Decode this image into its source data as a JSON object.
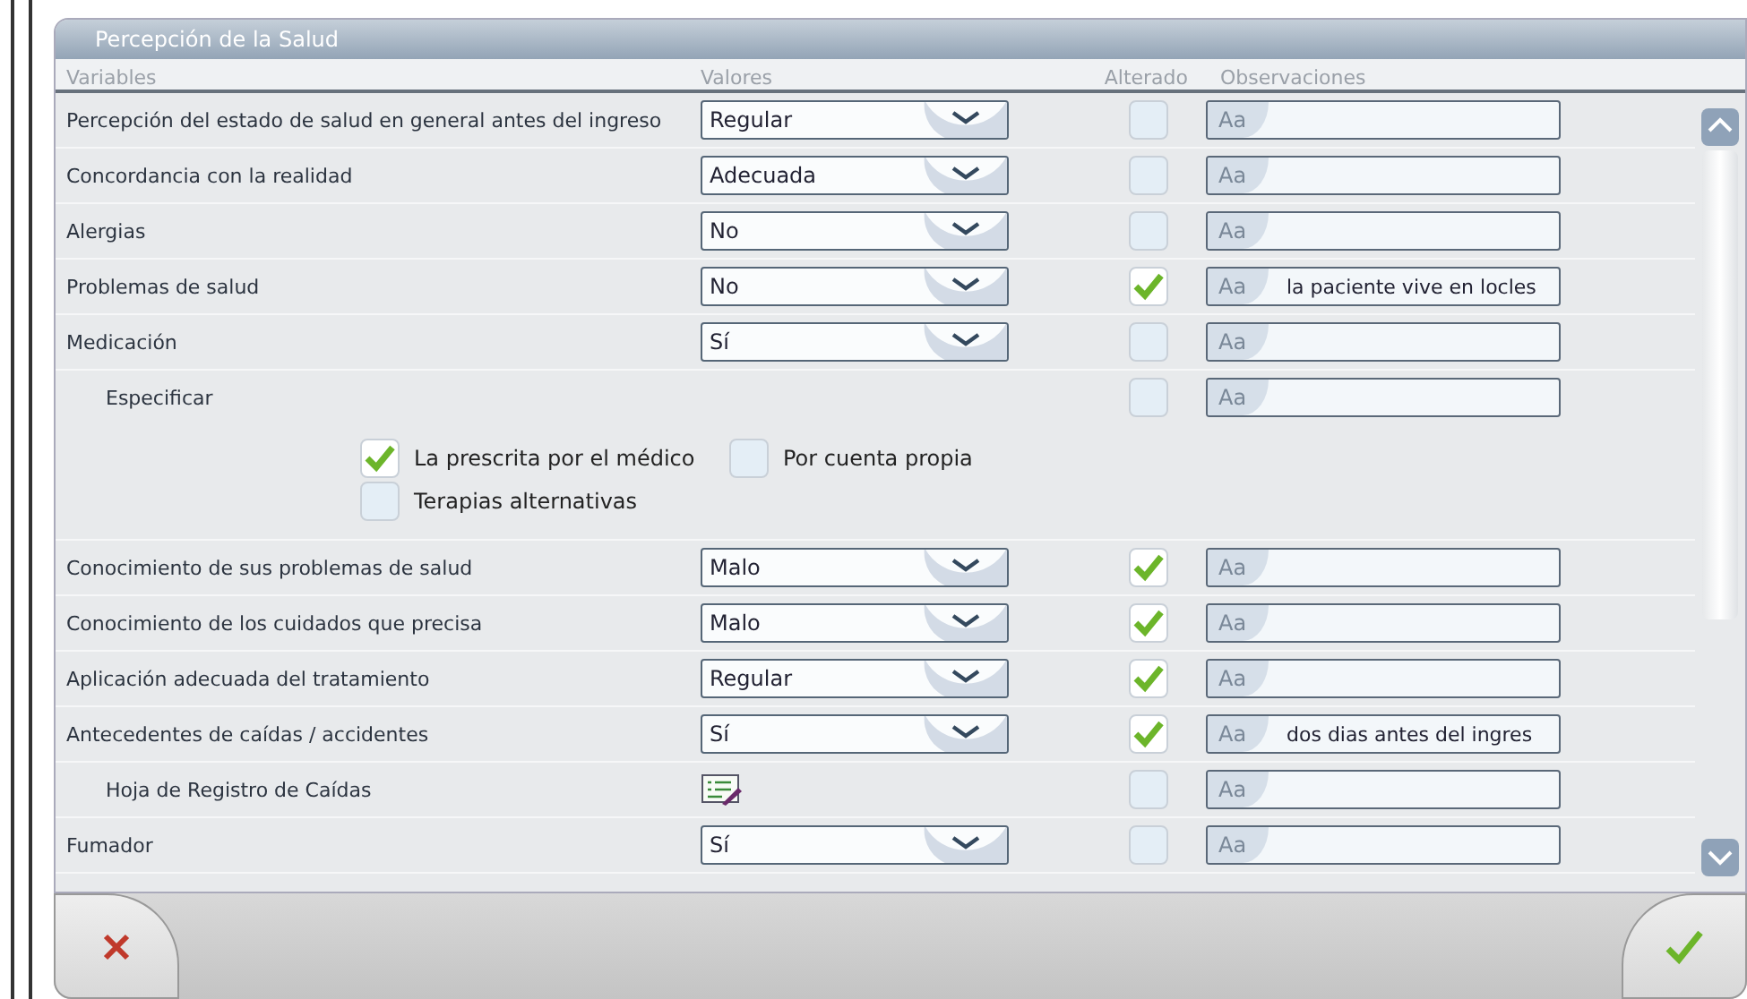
{
  "panel": {
    "title": "Percepción de la Salud"
  },
  "columns": [
    "Variables",
    "Valores",
    "Alterado",
    "Observaciones"
  ],
  "rows": [
    {
      "kind": "select",
      "label": "Percepción del estado de salud en general antes del ingreso",
      "value": "Regular",
      "altered": false,
      "observation": {
        "badge": "Aa"
      }
    },
    {
      "kind": "select",
      "label": "Concordancia con la realidad",
      "value": "Adecuada",
      "altered": false,
      "observation": {
        "badge": "Aa"
      }
    },
    {
      "kind": "select",
      "label": "Alergias",
      "value": "No",
      "altered": false,
      "observation": {
        "badge": "Aa"
      }
    },
    {
      "kind": "select",
      "label": "Problemas de salud",
      "value": "No",
      "altered": true,
      "observation": {
        "badge": "Aa",
        "value": "la paciente vive en locles"
      }
    },
    {
      "kind": "select",
      "label": "Medicación",
      "value": "Sí",
      "altered": false,
      "observation": {
        "badge": "Aa"
      },
      "children": [
        {
          "kind": "options",
          "label": "Especificar",
          "altered": false,
          "observation": {
            "badge": "Aa"
          },
          "options": [
            {
              "label": "La prescrita por el médico",
              "checked": true
            },
            {
              "label": "Por cuenta propia",
              "checked": false
            },
            {
              "label": "Terapias alternativas",
              "checked": false
            }
          ]
        }
      ]
    },
    {
      "kind": "select",
      "label": "Conocimiento de sus problemas de salud",
      "value": "Malo",
      "altered": true,
      "observation": {
        "badge": "Aa"
      }
    },
    {
      "kind": "select",
      "label": "Conocimiento de los cuidados que precisa",
      "value": "Malo",
      "altered": true,
      "observation": {
        "badge": "Aa"
      }
    },
    {
      "kind": "select",
      "label": "Aplicación adecuada del tratamiento",
      "value": "Regular",
      "altered": true,
      "observation": {
        "badge": "Aa"
      }
    },
    {
      "kind": "select",
      "label": "Antecedentes de caídas / accidentes",
      "value": "Sí",
      "altered": true,
      "observation": {
        "badge": "Aa",
        "value": "dos dias antes del ingres"
      },
      "children": [
        {
          "kind": "form",
          "label": "Hoja de Registro de Caídas",
          "altered": false,
          "observation": {
            "badge": "Aa"
          }
        }
      ]
    },
    {
      "kind": "select",
      "label": "Fumador",
      "value": "Sí",
      "altered": false,
      "observation": {
        "badge": "Aa"
      }
    }
  ]
}
